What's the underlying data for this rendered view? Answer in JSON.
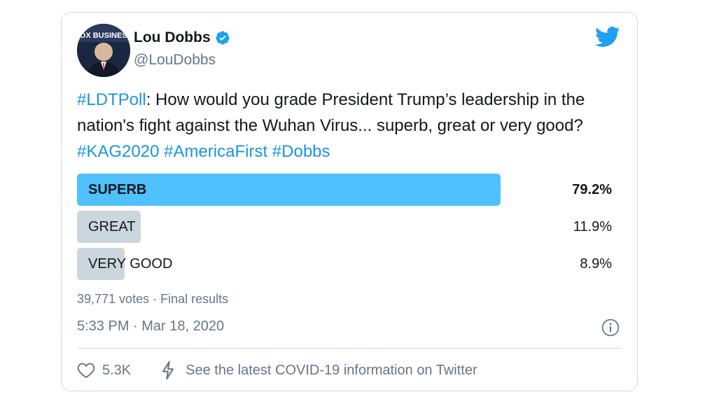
{
  "author": {
    "name": "Lou Dobbs",
    "handle": "@LouDobbs",
    "avatar_logo_text": "FOX BUSINESS"
  },
  "tweet": {
    "segments": [
      {
        "text": "#LDTPoll",
        "hashtag": true
      },
      {
        "text": ": How would you grade President Trump’s leadership in the nation's fight against the Wuhan Virus... superb, great or very good? ",
        "hashtag": false
      },
      {
        "text": "#KAG2020",
        "hashtag": true
      },
      {
        "text": " ",
        "hashtag": false
      },
      {
        "text": "#AmericaFirst",
        "hashtag": true
      },
      {
        "text": " ",
        "hashtag": false
      },
      {
        "text": "#Dobbs",
        "hashtag": true
      }
    ]
  },
  "poll": {
    "options": [
      {
        "label": "SUPERB",
        "percent_text": "79.2%",
        "percent": 79.2,
        "winner": true
      },
      {
        "label": "GREAT",
        "percent_text": "11.9%",
        "percent": 11.9,
        "winner": false
      },
      {
        "label": "VERY GOOD",
        "percent_text": "8.9%",
        "percent": 8.9,
        "winner": false
      }
    ],
    "meta": "39,771 votes · Final results"
  },
  "timestamp": "5:33 PM · Mar 18, 2020",
  "actions": {
    "like_count": "5.3K",
    "covid_link": "See the latest COVID-19 information on Twitter"
  },
  "colors": {
    "accent": "#1b95e0",
    "twitter_blue": "#1da1f2",
    "winner_bar": "#4fc1ff",
    "loser_bar": "#ccd6dd",
    "secondary_text": "#657786"
  },
  "icons": [
    "verified-badge-icon",
    "twitter-bird-icon",
    "info-icon",
    "heart-icon",
    "lightning-icon"
  ]
}
